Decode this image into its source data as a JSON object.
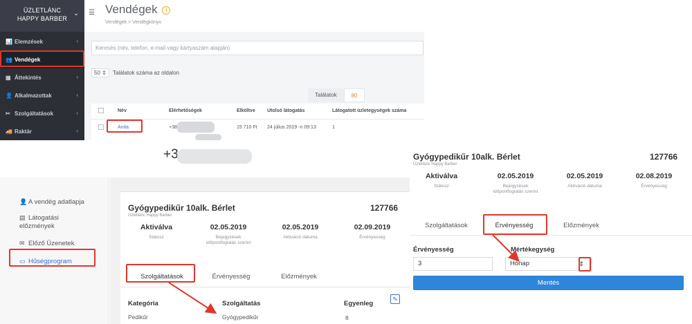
{
  "crm": {
    "brand": "ÜZLETLÁNC HAPPY BARBER",
    "sidebar": [
      {
        "icon": "📊",
        "label": "Elemzések"
      },
      {
        "icon": "👥",
        "label": "Vendégek"
      },
      {
        "icon": "▦",
        "label": "Áttekintés"
      },
      {
        "icon": "👤",
        "label": "Alkalmazottak"
      },
      {
        "icon": "✂",
        "label": "Szolgáltatások"
      },
      {
        "icon": "🚚",
        "label": "Raktár"
      }
    ],
    "page_title": "Vendégek",
    "breadcrumb": "Vendégek  >  Vendégkönyv",
    "search_placeholder": "Keresés (név, telefon, e-mail vagy kártyaszám alapján)",
    "per_page_value": "50",
    "per_page_label": "Találatok száma az oldalon",
    "results_label": "Találatok",
    "results_count": "80",
    "table": {
      "columns": [
        "Név",
        "Elérhetőségek",
        "Elköltve",
        "Utolsó látogatás",
        "Látogatott üzletegységek száma"
      ],
      "row": {
        "name": "Anita",
        "contact": "+38",
        "spent": "15 710 Ft",
        "last_visit": "24 július 2019 -n 09:13",
        "units": "1"
      }
    }
  },
  "guest_profile": {
    "phone_prefix": "+3",
    "nav": [
      {
        "icon": "👤",
        "label": "A vendég adatlapja"
      },
      {
        "icon": "▤",
        "label": "Látogatási előzmények"
      },
      {
        "icon": "✉",
        "label": "Előző Üzenetek"
      },
      {
        "icon": "▭",
        "label": "Hűségprogram"
      }
    ],
    "card": {
      "title": "Gyógypedikűr 10alk. Bérlet",
      "id": "127766",
      "subtitle": "Üzletlánc Happy Barber",
      "stats": [
        {
          "value": "Aktiválva",
          "label": "Státusz"
        },
        {
          "value": "02.05.2019",
          "label": "Bejegyzések időpontfoglalás szerint"
        },
        {
          "value": "02.05.2019",
          "label": "Aktiváció dátuma"
        },
        {
          "value": "02.09.2019",
          "label": "Érvényesség"
        }
      ],
      "tabs": [
        "Szolgáltatások",
        "Érvényesség",
        "Előzmények"
      ],
      "table_headers": [
        "Kategória",
        "Szolgáltatás",
        "Egyenleg"
      ],
      "table_row": {
        "category": "Pedikűr",
        "service": "Gyógypedikűr",
        "balance": "8"
      }
    }
  },
  "validity_card": {
    "title": "Gyógypedikűr 10alk. Bérlet",
    "id": "127766",
    "subtitle": "Üzletlánc Happy Barber",
    "stats": [
      {
        "value": "Aktiválva",
        "label": "Státusz"
      },
      {
        "value": "02.05.2019",
        "label": "Bejegyzések időpontfoglalás szerint"
      },
      {
        "value": "02.05.2019",
        "label": "Aktiváció dátuma"
      },
      {
        "value": "02.08.2019",
        "label": "Érvényesség"
      }
    ],
    "tabs": [
      "Szolgáltatások",
      "Érvényesség",
      "Előzmények"
    ],
    "validity_label": "Érvényesség",
    "validity_value": "3",
    "unit_label": "Mértékegység",
    "unit_value": "Hónap",
    "save_label": "Mentés"
  },
  "colors": {
    "highlight": "#e0362d",
    "link_blue": "#3b6fc9",
    "save_button": "#2d86d8",
    "accent_orange": "#e8803b"
  }
}
